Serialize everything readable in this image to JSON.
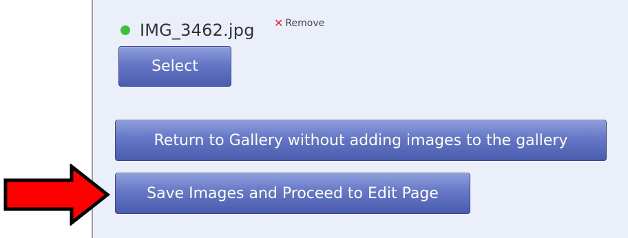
{
  "upload": {
    "cutoff_text": "",
    "file_name": "IMG_3462.jpg",
    "remove_label": "Remove",
    "status_color": "#3bc13b"
  },
  "buttons": {
    "select_label": "Select",
    "return_label": "Return to Gallery without adding images to the gallery",
    "save_label": "Save Images and Proceed to Edit Page"
  },
  "annotation": {
    "arrow_color": "#ff0000",
    "arrow_icon": "red-arrow-right-icon"
  },
  "colors": {
    "panel_bg": "#eaeff9",
    "button_top": "#8e9fdc",
    "button_bottom": "#4b5cae"
  }
}
